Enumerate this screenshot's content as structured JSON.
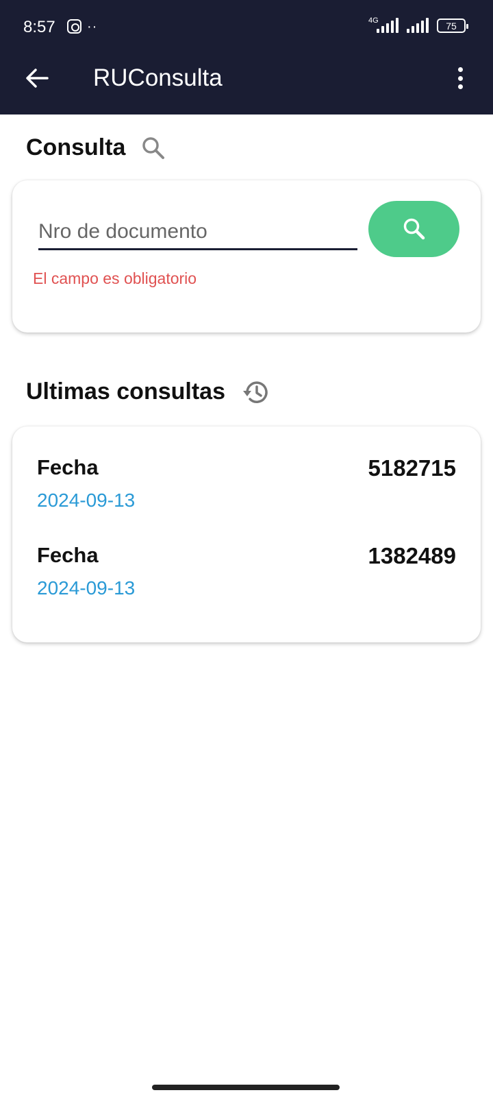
{
  "status_bar": {
    "time": "8:57",
    "network": "4G",
    "battery": "75"
  },
  "app_bar": {
    "title": "RUConsulta"
  },
  "search_section": {
    "title": "Consulta",
    "input_placeholder": "Nro de documento",
    "input_value": "",
    "error": "El campo es obligatorio"
  },
  "history_section": {
    "title": "Ultimas consultas",
    "items": [
      {
        "label": "Fecha",
        "date": "2024-09-13",
        "number": "5182715"
      },
      {
        "label": "Fecha",
        "date": "2024-09-13",
        "number": "1382489"
      }
    ]
  },
  "colors": {
    "app_bar": "#1a1d33",
    "search_button": "#4ecb8a",
    "error": "#e05151",
    "date_link": "#2a9ad6"
  }
}
